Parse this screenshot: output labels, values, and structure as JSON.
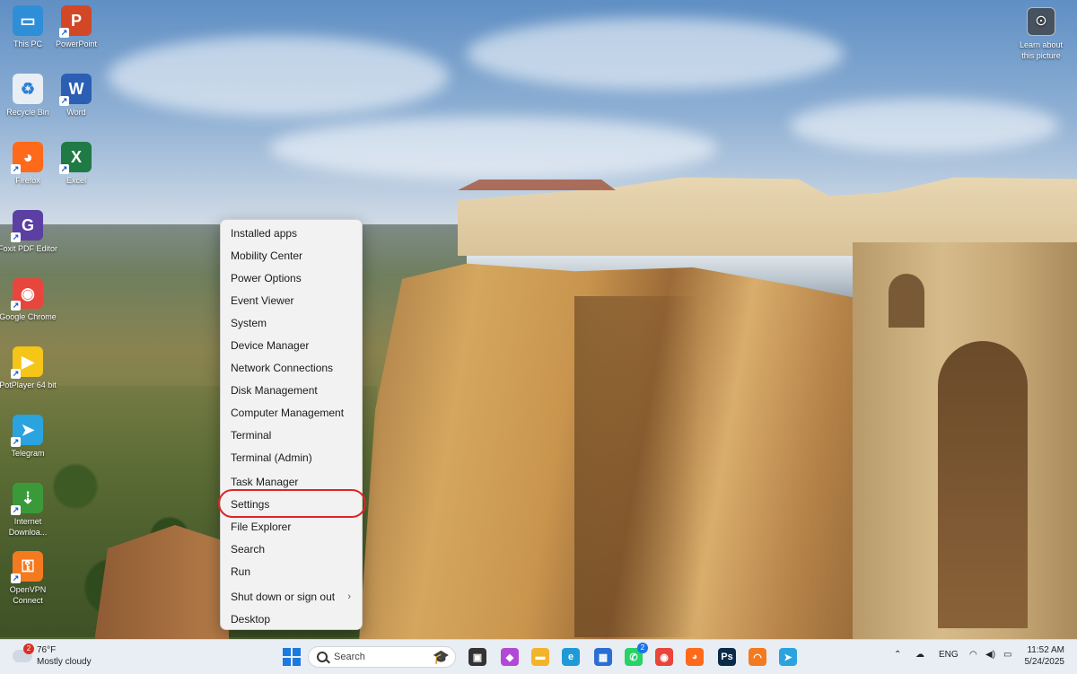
{
  "desktop": {
    "icons": [
      {
        "label": "This PC",
        "icon": "this-pc-icon",
        "color": "#2f8ed8"
      },
      {
        "label": "PowerPoint",
        "icon": "powerpoint-icon",
        "color": "#d24726"
      },
      {
        "label": "Recycle Bin",
        "icon": "recycle-bin-icon",
        "color": "#e8eef4"
      },
      {
        "label": "Word",
        "icon": "word-icon",
        "color": "#2b5fb3"
      },
      {
        "label": "Firefox",
        "icon": "firefox-icon",
        "color": "#ff6a1a"
      },
      {
        "label": "Excel",
        "icon": "excel-icon",
        "color": "#1f7a45"
      },
      {
        "label": "Foxit PDF Editor",
        "icon": "foxit-pdf-icon",
        "color": "#5b3fa3"
      },
      {
        "label": "Google Chrome",
        "icon": "chrome-icon",
        "color": "#e8453c"
      },
      {
        "label": "PotPlayer 64 bit",
        "icon": "potplayer-icon",
        "color": "#f5c518"
      },
      {
        "label": "Telegram",
        "icon": "telegram-icon",
        "color": "#2aa3df"
      },
      {
        "label": "Internet Downloa...",
        "icon": "internet-download-manager-icon",
        "color": "#3a9a3a"
      },
      {
        "label": "OpenVPN Connect",
        "icon": "openvpn-icon",
        "color": "#f47a20"
      }
    ],
    "learn_about": "Learn about this picture"
  },
  "context_menu": {
    "items": [
      {
        "label": "Installed apps"
      },
      {
        "label": "Mobility Center"
      },
      {
        "label": "Power Options"
      },
      {
        "label": "Event Viewer"
      },
      {
        "label": "System"
      },
      {
        "label": "Device Manager"
      },
      {
        "label": "Network Connections"
      },
      {
        "label": "Disk Management"
      },
      {
        "label": "Computer Management"
      },
      {
        "label": "Terminal"
      },
      {
        "label": "Terminal (Admin)"
      },
      {
        "label": "Task Manager"
      },
      {
        "label": "Settings",
        "highlighted": true
      },
      {
        "label": "File Explorer"
      },
      {
        "label": "Search"
      },
      {
        "label": "Run"
      },
      {
        "label": "Shut down or sign out",
        "submenu": true
      },
      {
        "label": "Desktop"
      }
    ],
    "highlight_color": "#e02424"
  },
  "taskbar": {
    "weather": {
      "temp": "76°F",
      "condition": "Mostly cloudy",
      "badge": "2"
    },
    "search_placeholder": "Search",
    "apps": [
      {
        "name": "task-view-icon",
        "glyph": "▣",
        "color": "#333333"
      },
      {
        "name": "copilot-icon",
        "glyph": "◆",
        "color": "#b04ad6"
      },
      {
        "name": "file-explorer-icon",
        "glyph": "▬",
        "color": "#f2b42a"
      },
      {
        "name": "edge-icon",
        "glyph": "e",
        "color": "#1f9ad6"
      },
      {
        "name": "microsoft-store-icon",
        "glyph": "▦",
        "color": "#2a6fd4"
      },
      {
        "name": "whatsapp-icon",
        "glyph": "✆",
        "color": "#25d366",
        "badge": "2"
      },
      {
        "name": "chrome-icon",
        "glyph": "◉",
        "color": "#e8453c"
      },
      {
        "name": "firefox-icon",
        "glyph": "◕",
        "color": "#ff6a1a"
      },
      {
        "name": "photoshop-icon",
        "glyph": "Ps",
        "color": "#0a2a4a"
      },
      {
        "name": "openvpn-icon",
        "glyph": "◠",
        "color": "#f47a20"
      },
      {
        "name": "telegram-icon",
        "glyph": "➤",
        "color": "#2aa3df"
      }
    ],
    "tray": {
      "language": "ENG"
    },
    "clock": {
      "time": "11:52 AM",
      "date": "5/24/2025"
    }
  }
}
